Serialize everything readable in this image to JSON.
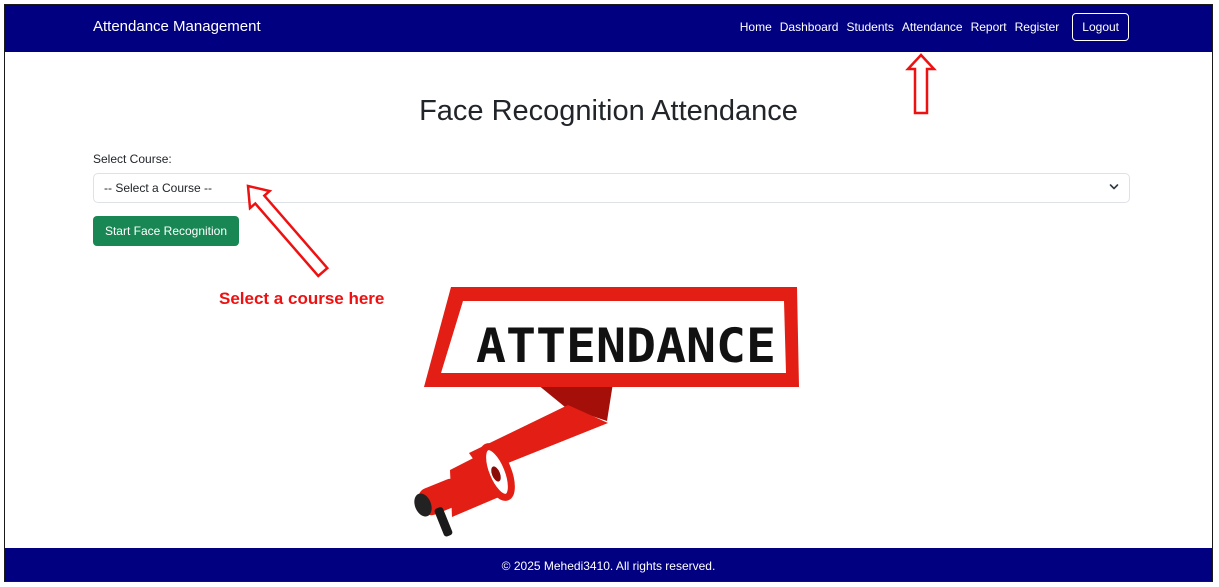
{
  "navbar": {
    "brand": "Attendance Management",
    "links": [
      "Home",
      "Dashboard",
      "Students",
      "Attendance",
      "Report",
      "Register"
    ],
    "logout_label": "Logout"
  },
  "main": {
    "title": "Face Recognition Attendance",
    "course_label": "Select Course:",
    "course_selected": "-- Select a Course --",
    "start_button_label": "Start Face Recognition"
  },
  "annotation": {
    "hint_text": "Select a course here",
    "color": "#ee1111"
  },
  "illustration": {
    "banner_text": "ATTENDANCE",
    "icon": "megaphone-icon"
  },
  "footer": {
    "text": "© 2025 Mehedi3410. All rights reserved."
  },
  "colors": {
    "navbar_bg": "#000080",
    "button_green": "#198754",
    "accent_red": "#e31e14"
  }
}
